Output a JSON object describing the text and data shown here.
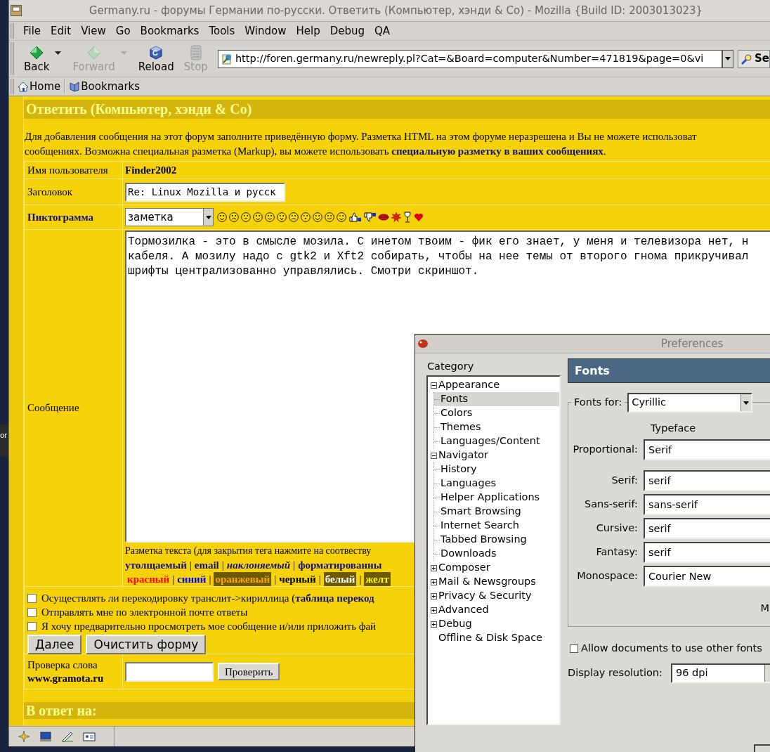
{
  "desktop": {
    "fragment_text": "or"
  },
  "window": {
    "title": "Germany.ru - форумы Германии по-русски. Ответить (Компьютер, хэнди & Co) - Mozilla {Build ID: 2003013023}"
  },
  "menu_bar": [
    {
      "label": "File"
    },
    {
      "label": "Edit"
    },
    {
      "label": "View"
    },
    {
      "label": "Go"
    },
    {
      "label": "Bookmarks"
    },
    {
      "label": "Tools"
    },
    {
      "label": "Window"
    },
    {
      "label": "Help"
    },
    {
      "label": "Debug"
    },
    {
      "label": "QA"
    }
  ],
  "nav_toolbar": {
    "buttons": [
      {
        "label": "Back",
        "kind": "back",
        "disabled": false,
        "has_menu": true
      },
      {
        "label": "Forward",
        "kind": "forward",
        "disabled": true,
        "has_menu": true
      },
      {
        "label": "Reload",
        "kind": "reload",
        "disabled": false,
        "has_menu": false
      },
      {
        "label": "Stop",
        "kind": "stop",
        "disabled": true,
        "has_menu": false
      }
    ],
    "url": "http://foren.germany.ru/newreply.pl?Cat=&Board=computer&Number=471819&page=0&vi",
    "search_button": "Se"
  },
  "personal_toolbar": [
    {
      "label": "Home",
      "kind": "home"
    },
    {
      "label": "Bookmarks",
      "kind": "bookmarks"
    }
  ],
  "page": {
    "heading": "Ответить (Компьютер, хэнди & Co)",
    "intro": {
      "line_1": "Для добавления сообщения на этот форум заполните приведённую форму. Разметка HTML на этом форуме неразрешена и Вы не можете использоват",
      "line_2": "сообщениях. Возможна специальная разметка (Markup), вы можете использовать ",
      "link": "специальную разметку в ваших сообщениях",
      "end": "."
    },
    "form": {
      "username": {
        "label": "Имя пользователя",
        "value": "Finder2002"
      },
      "subject": {
        "label": "Заголовок",
        "value": "Re: Linux Mozilla и русск"
      },
      "icon": {
        "label": "Пиктограмма",
        "value": "заметка"
      },
      "message": {
        "label": "Сообщение",
        "text_lines": [
          "Тормозилка - это в смысле мозила. С инетом твоим - фик его знает, у меня и телевизора нет, н",
          "кабеля. А мозилу надо с gtk2 и Xft2 собирать, чтобы на нее темы от второго гнома прикручивал",
          "шрифты централизованно управлялись. Смотри скриншот."
        ],
        "markup_hint": "Разметка текста (для закрытия тега нажмите на соотвеству",
        "separator": "|",
        "markup_tags": [
          {
            "label": "утолщаемый",
            "kind": "bold"
          },
          {
            "label": "email",
            "kind": "bold"
          },
          {
            "label": "наклоняемый",
            "kind": "italic"
          },
          {
            "label": "форматированны",
            "kind": "bold"
          }
        ],
        "color_tags": [
          {
            "label": "красный",
            "color": "#ff0000"
          },
          {
            "label": "синий",
            "color": "#0000ff"
          },
          {
            "label": "оранжевый",
            "color": "#ffa500"
          },
          {
            "label": "черный",
            "color": "#000000"
          },
          {
            "label": "белый",
            "color": "#ffffff"
          },
          {
            "label": "желт",
            "color": "#ffff00"
          }
        ]
      },
      "options": [
        {
          "label": "Осуществлять ли перекодировку транслит->кириллица (",
          "link": "таблица перекод",
          "checked": false
        },
        {
          "label": "Отправлять мне по электронной почте ответы",
          "checked": false
        },
        {
          "label": "Я хочу предварительно просмотреть мое сообщение и/или приложить фай",
          "checked": false
        }
      ],
      "buttons": [
        "Далее",
        "Очистить форму"
      ],
      "word_check": {
        "label_1": "Проверка слова",
        "label_2": "www.gramota.ru",
        "button": "Проверить"
      }
    },
    "reply_heading": "В ответ на:"
  },
  "preferences": {
    "title": "Preferences",
    "category_label": "Category",
    "tree": [
      {
        "label": "Appearance",
        "kind": "folder",
        "expanded": true,
        "selected": false,
        "children": [
          {
            "label": "Fonts",
            "selected": true
          },
          {
            "label": "Colors",
            "selected": false
          },
          {
            "label": "Themes",
            "selected": false
          },
          {
            "label": "Languages/Content",
            "selected": false
          }
        ]
      },
      {
        "label": "Navigator",
        "kind": "folder",
        "expanded": true,
        "selected": false,
        "children": [
          {
            "label": "History",
            "selected": false
          },
          {
            "label": "Languages",
            "selected": false
          },
          {
            "label": "Helper Applications",
            "selected": false
          },
          {
            "label": "Smart Browsing",
            "selected": false
          },
          {
            "label": "Internet Search",
            "selected": false
          },
          {
            "label": "Tabbed Browsing",
            "selected": false
          },
          {
            "label": "Downloads",
            "selected": false
          }
        ]
      },
      {
        "label": "Composer",
        "kind": "folder",
        "expanded": false,
        "selected": false
      },
      {
        "label": "Mail & Newsgroups",
        "kind": "folder",
        "expanded": false,
        "selected": false
      },
      {
        "label": "Privacy & Security",
        "kind": "folder",
        "expanded": false,
        "selected": false
      },
      {
        "label": "Advanced",
        "kind": "folder",
        "expanded": false,
        "selected": false
      },
      {
        "label": "Debug",
        "kind": "folder",
        "expanded": false,
        "selected": false
      },
      {
        "label": "Offline & Disk Space",
        "kind": "leaf",
        "selected": false
      }
    ],
    "panel_title": "Fonts",
    "fonts_for": {
      "label": "Fonts for:",
      "value": "Cyrillic"
    },
    "typeface_header": "Typeface",
    "font_rows": [
      {
        "label": "Proportional:",
        "value": "Serif"
      },
      {
        "label": "Serif:",
        "value": "serif"
      },
      {
        "label": "Sans-serif:",
        "value": "sans-serif"
      },
      {
        "label": "Cursive:",
        "value": "serif"
      },
      {
        "label": "Fantasy:",
        "value": "serif"
      },
      {
        "label": "Monospace:",
        "value": "Courier New"
      }
    ],
    "cut_text": "M",
    "allow_fonts": {
      "label": "Allow documents to use other fonts",
      "checked": false
    },
    "resolution": {
      "label": "Display resolution:",
      "value": "96 dpi"
    }
  }
}
